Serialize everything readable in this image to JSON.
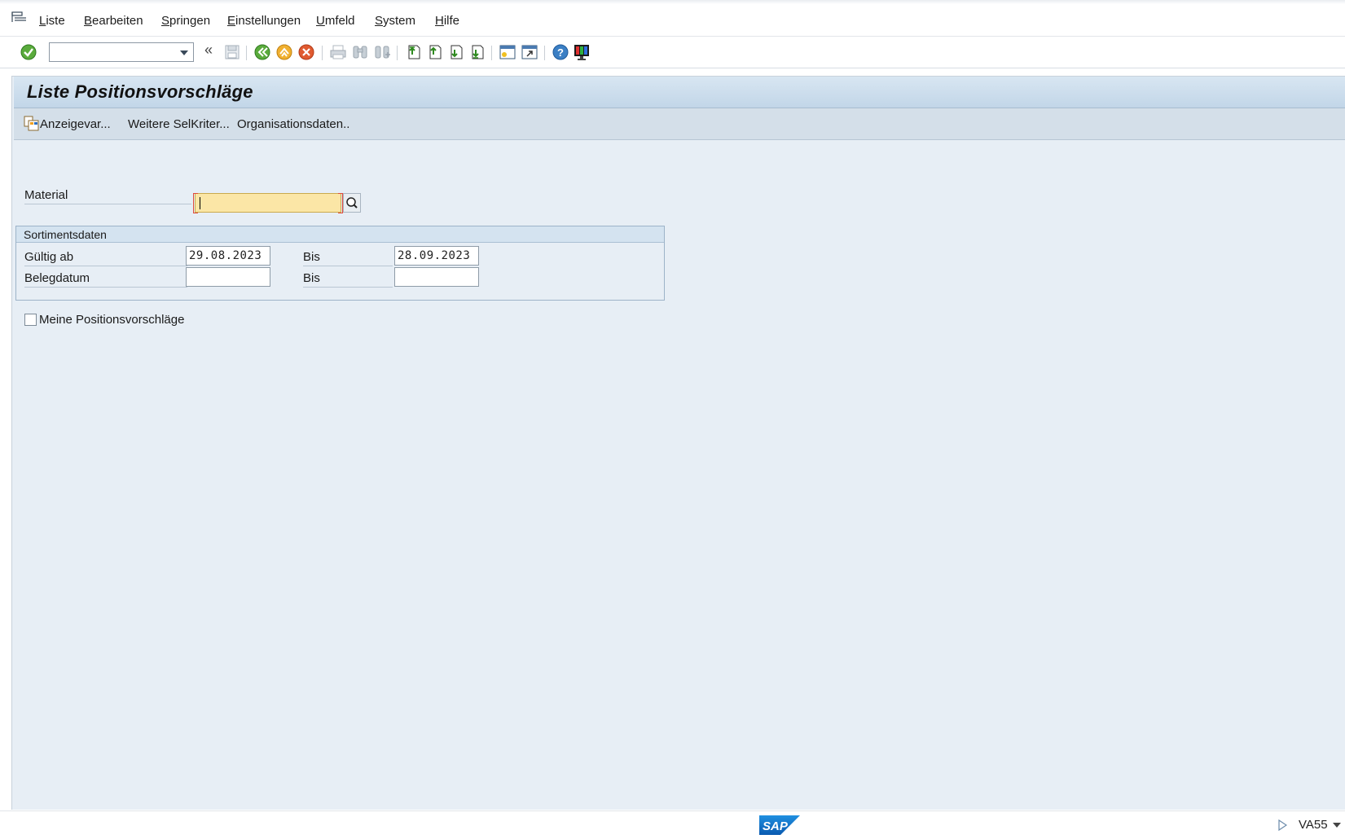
{
  "menu": {
    "items": [
      {
        "first": "L",
        "rest": "iste"
      },
      {
        "first": "B",
        "rest": "earbeiten"
      },
      {
        "first": "S",
        "rest": "pringen"
      },
      {
        "first": "E",
        "rest": "instellungen"
      },
      {
        "first": "U",
        "rest": "mfeld"
      },
      {
        "first": "S",
        "rest": "ystem"
      },
      {
        "first": "H",
        "rest": "ilfe"
      }
    ]
  },
  "toolbar": {
    "command_value": "",
    "icons": [
      "enter-icon",
      "save-icon",
      "back-icon",
      "exit-icon",
      "cancel-icon",
      "print-icon",
      "find-icon",
      "find-next-icon",
      "first-page-icon",
      "previous-page-icon",
      "next-page-icon",
      "last-page-icon",
      "new-session-icon",
      "shortcut-icon",
      "help-icon",
      "customize-layout-icon"
    ]
  },
  "title": "Liste Positionsvorschläge",
  "app_toolbar": {
    "display_variants": "Anzeigevar...",
    "further_criteria": "Weitere SelKriter...",
    "org_data": "Organisationsdaten.."
  },
  "material": {
    "label": "Material",
    "value": ""
  },
  "assortment": {
    "title": "Sortimentsdaten",
    "valid_from_label": "Gültig ab",
    "valid_from": "29.08.2023",
    "valid_to_label": "Bis",
    "valid_to": "28.09.2023",
    "doc_date_label": "Belegdatum",
    "doc_date_from": "",
    "doc_date_to_label": "Bis",
    "doc_date_to": ""
  },
  "my_proposals": {
    "label": "Meine Positionsvorschläge",
    "checked": false
  },
  "statusbar": {
    "logo": "SAP",
    "tcode": "VA55"
  },
  "colors": {
    "required_field": "#fbe6a6",
    "background": "#e7eef5",
    "title_bar": "#c2d6e8"
  }
}
